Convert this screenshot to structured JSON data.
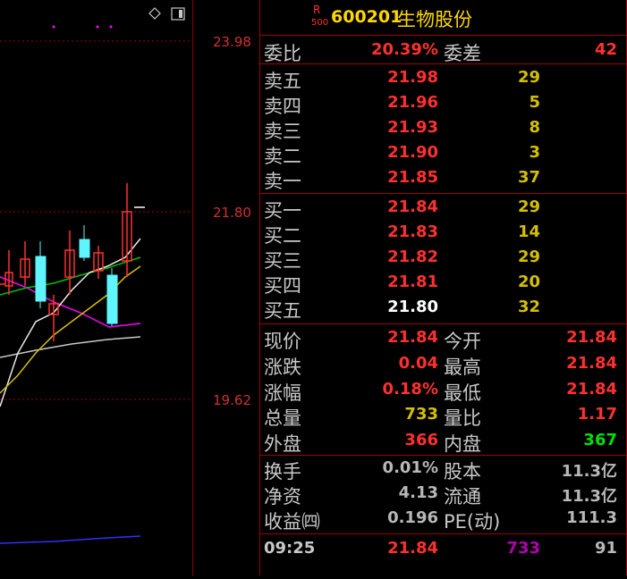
{
  "chart": {
    "price_labels": [
      "23.98",
      "21.80",
      "19.62"
    ],
    "icons": [
      "diamond-icon",
      "panel-toggle-icon"
    ]
  },
  "header": {
    "r_badge": "R",
    "r_sub": "500",
    "code": "600201",
    "name": "生物股份"
  },
  "weibi": {
    "label": "委比",
    "value": "20.39%",
    "label2": "委差",
    "value2": "42"
  },
  "sell": [
    {
      "label": "卖五",
      "price": "21.98",
      "qty": "29"
    },
    {
      "label": "卖四",
      "price": "21.96",
      "qty": "5"
    },
    {
      "label": "卖三",
      "price": "21.93",
      "qty": "8"
    },
    {
      "label": "卖二",
      "price": "21.90",
      "qty": "3"
    },
    {
      "label": "卖一",
      "price": "21.85",
      "qty": "37"
    }
  ],
  "buy": [
    {
      "label": "买一",
      "price": "21.84",
      "qty": "29"
    },
    {
      "label": "买二",
      "price": "21.83",
      "qty": "14"
    },
    {
      "label": "买三",
      "price": "21.82",
      "qty": "29"
    },
    {
      "label": "买四",
      "price": "21.81",
      "qty": "20"
    },
    {
      "label": "买五",
      "price": "21.80",
      "qty": "32"
    }
  ],
  "stats": [
    {
      "label": "现价",
      "value": "21.84",
      "label2": "今开",
      "value2": "21.84"
    },
    {
      "label": "涨跌",
      "value": "0.04",
      "label2": "最高",
      "value2": "21.84"
    },
    {
      "label": "涨幅",
      "value": "0.18%",
      "label2": "最低",
      "value2": "21.84"
    },
    {
      "label": "总量",
      "value": "733",
      "label2": "量比",
      "value2": "1.17"
    },
    {
      "label": "外盘",
      "value": "366",
      "label2": "内盘",
      "value2": "367"
    }
  ],
  "extra": [
    {
      "label": "换手",
      "value": "0.01%",
      "label2": "股本",
      "value2": "11.3亿"
    },
    {
      "label": "净资",
      "value": "4.13",
      "label2": "流通",
      "value2": "11.3亿"
    },
    {
      "label": "收益㈣",
      "value": "0.196",
      "label2": "PE(动)",
      "value2": "111.3"
    }
  ],
  "tick": {
    "time": "09:25",
    "price": "21.84",
    "volume": "733",
    "count": "91"
  },
  "colors": {
    "up": "#ff3030",
    "volume": "#d4c000",
    "down": "#00e000",
    "border": "#a00000",
    "candle_down": "#5ff5ff"
  }
}
